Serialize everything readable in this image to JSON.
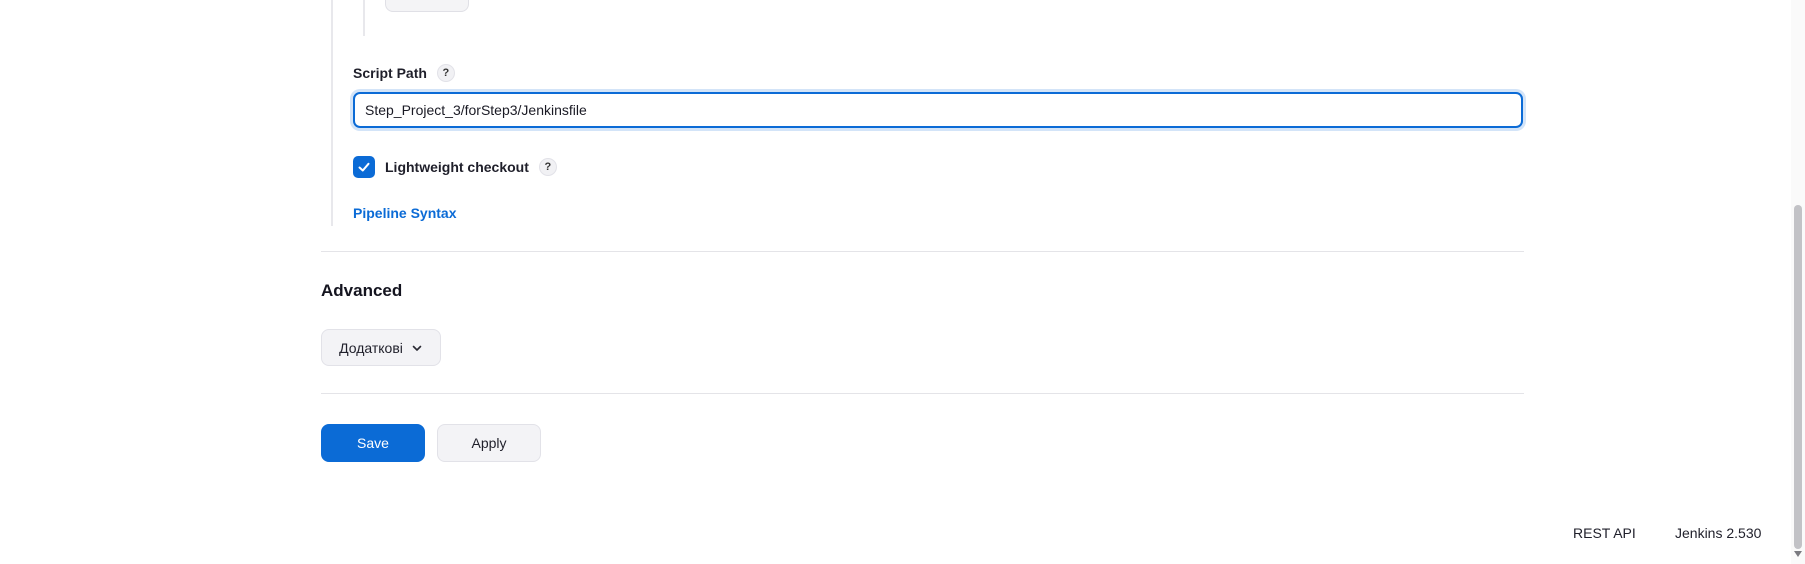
{
  "pipeline": {
    "script_path_label": "Script Path",
    "script_path_value": "Step_Project_3/forStep3/Jenkinsfile",
    "help_label": "?",
    "lightweight_checkout_label": "Lightweight checkout",
    "lightweight_checkout_checked": true,
    "pipeline_syntax_link": "Pipeline Syntax"
  },
  "advanced": {
    "title": "Advanced",
    "dropdown_label": "Додаткові"
  },
  "actions": {
    "save_label": "Save",
    "apply_label": "Apply"
  },
  "footer": {
    "rest_api_label": "REST API",
    "version_label": "Jenkins 2.530"
  },
  "colors": {
    "accent": "#0b6bd6",
    "button_secondary_bg": "#f3f3f6",
    "divider": "#e4e4e8"
  }
}
